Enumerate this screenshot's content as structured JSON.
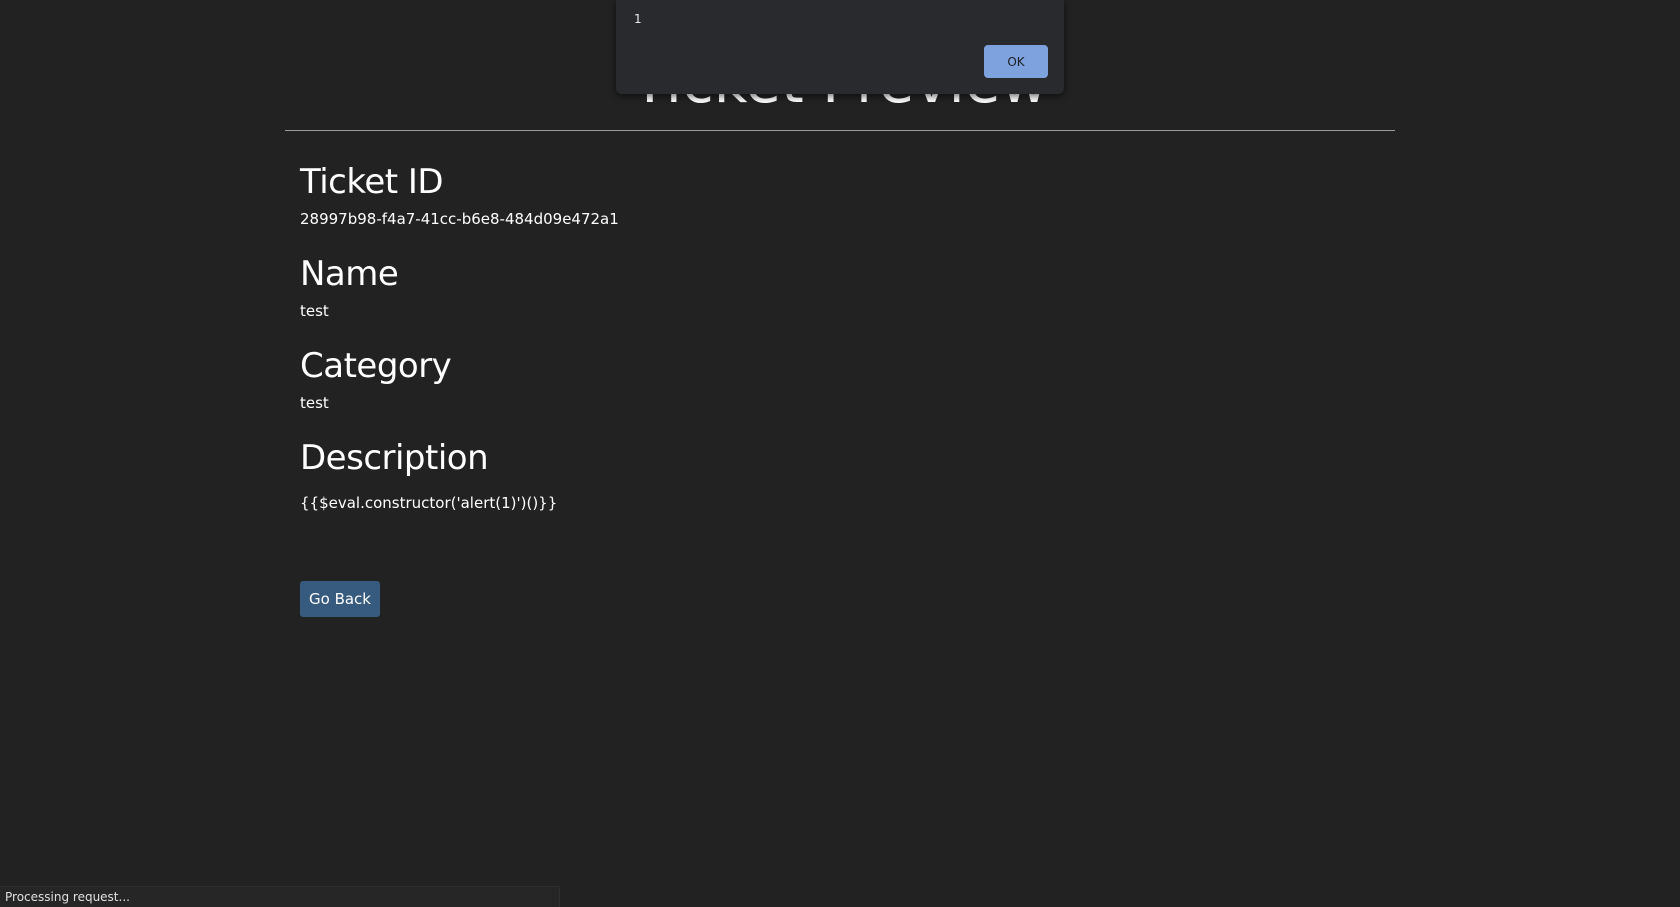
{
  "page": {
    "title": "Ticket Preview"
  },
  "ticket": {
    "fields": [
      {
        "heading": "Ticket ID",
        "value": "28997b98-f4a7-41cc-b6e8-484d09e472a1"
      },
      {
        "heading": "Name",
        "value": "test"
      },
      {
        "heading": "Category",
        "value": "test"
      },
      {
        "heading": "Description",
        "value": "{{$eval.constructor('alert(1)')()}}"
      }
    ],
    "go_back_label": "Go Back"
  },
  "alert": {
    "message": "1",
    "ok_label": "OK"
  },
  "status_bar": {
    "text": "Processing request..."
  },
  "colors": {
    "background": "#222222",
    "primary_button": "#375a7f",
    "dialog_background": "#292a2d",
    "dialog_ok_button": "#7ea2de"
  }
}
